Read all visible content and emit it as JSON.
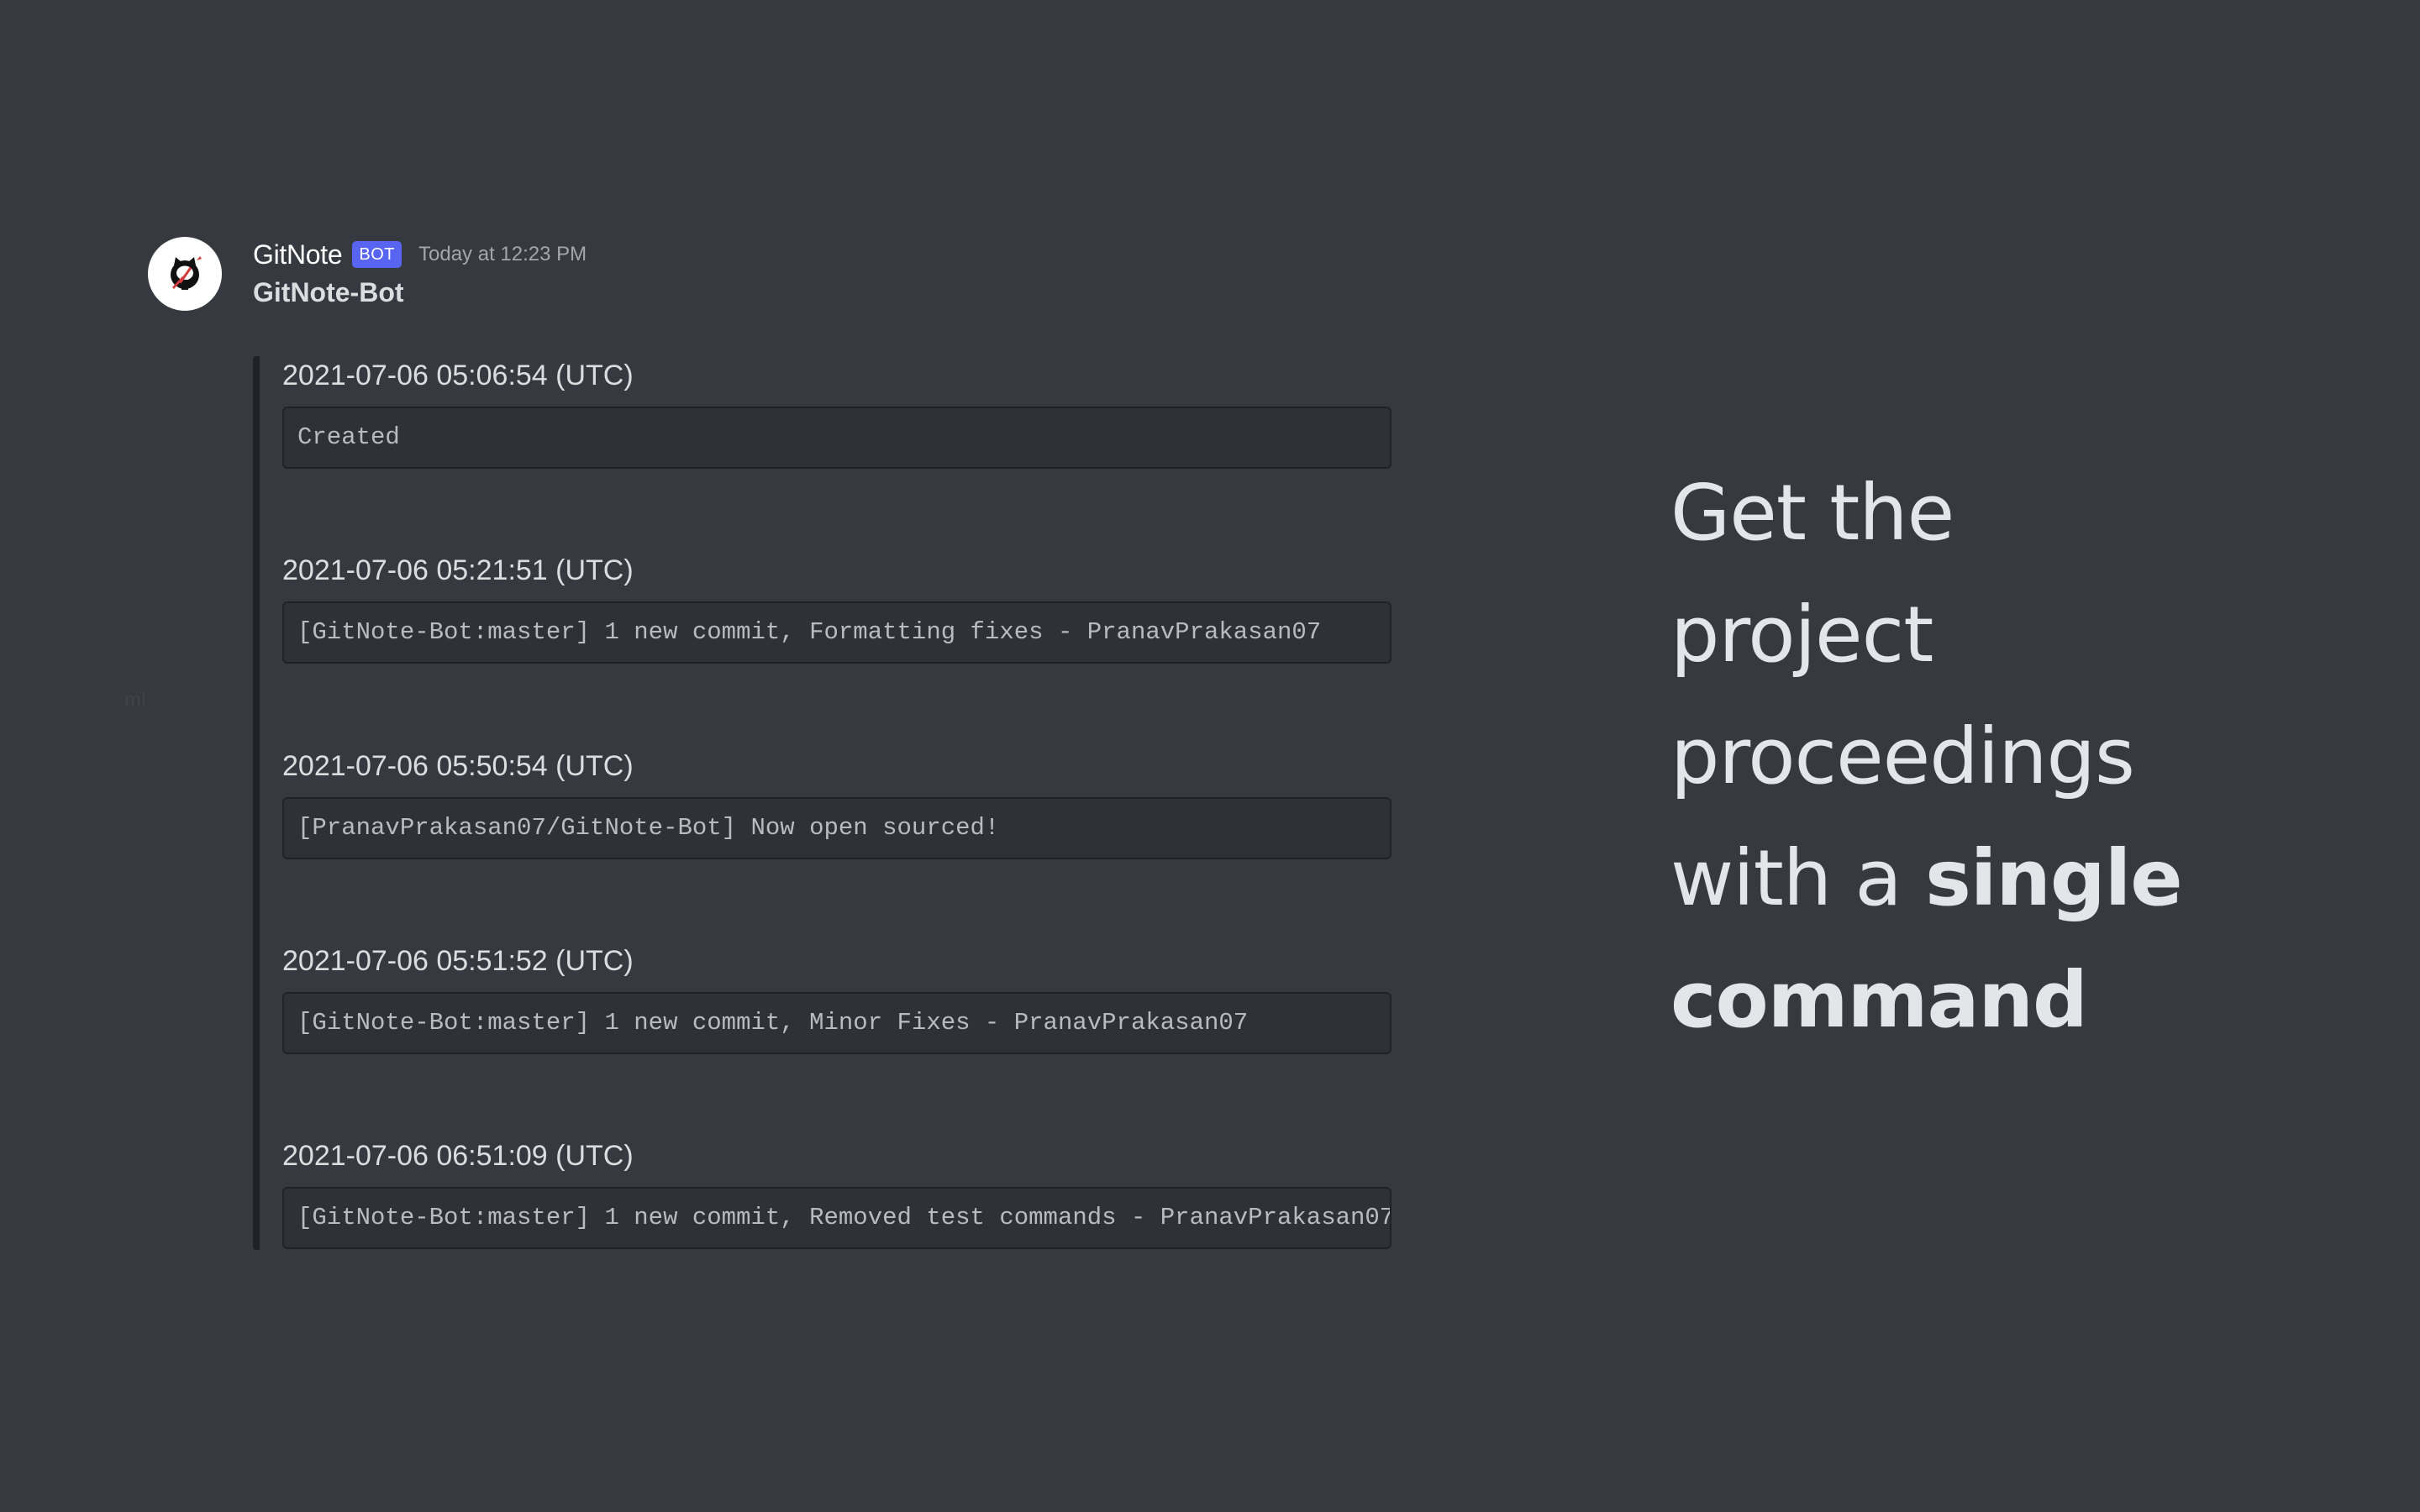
{
  "message": {
    "username": "GitNote",
    "bot_tag": "BOT",
    "timestamp": "Today at 12:23 PM",
    "author": "GitNote-Bot"
  },
  "entries": [
    {
      "title": "2021-07-06 05:06:54 (UTC)",
      "text": "Created"
    },
    {
      "title": "2021-07-06 05:21:51 (UTC)",
      "text": "[GitNote-Bot:master] 1 new commit, Formatting fixes - PranavPrakasan07"
    },
    {
      "title": "2021-07-06 05:50:54 (UTC)",
      "text": "[PranavPrakasan07/GitNote-Bot] Now open sourced!"
    },
    {
      "title": "2021-07-06 05:51:52 (UTC)",
      "text": "[GitNote-Bot:master] 1 new commit, Minor Fixes - PranavPrakasan07"
    },
    {
      "title": "2021-07-06 06:51:09 (UTC)",
      "text": "[GitNote-Bot:master] 1 new commit, Removed test commands - PranavPrakasan07"
    }
  ],
  "ghost_text": "ml",
  "headline": {
    "line1": "Get the",
    "line2": "project",
    "line3": "proceedings",
    "line4_normal": "with a ",
    "line4_bold": "single",
    "line5_bold": "command"
  },
  "colors": {
    "background": "#363940",
    "bot_tag": "#5865f2",
    "embed_bar": "#202225",
    "code_bg": "#2f3136"
  },
  "icons": {
    "avatar": "github-octocat-icon"
  }
}
